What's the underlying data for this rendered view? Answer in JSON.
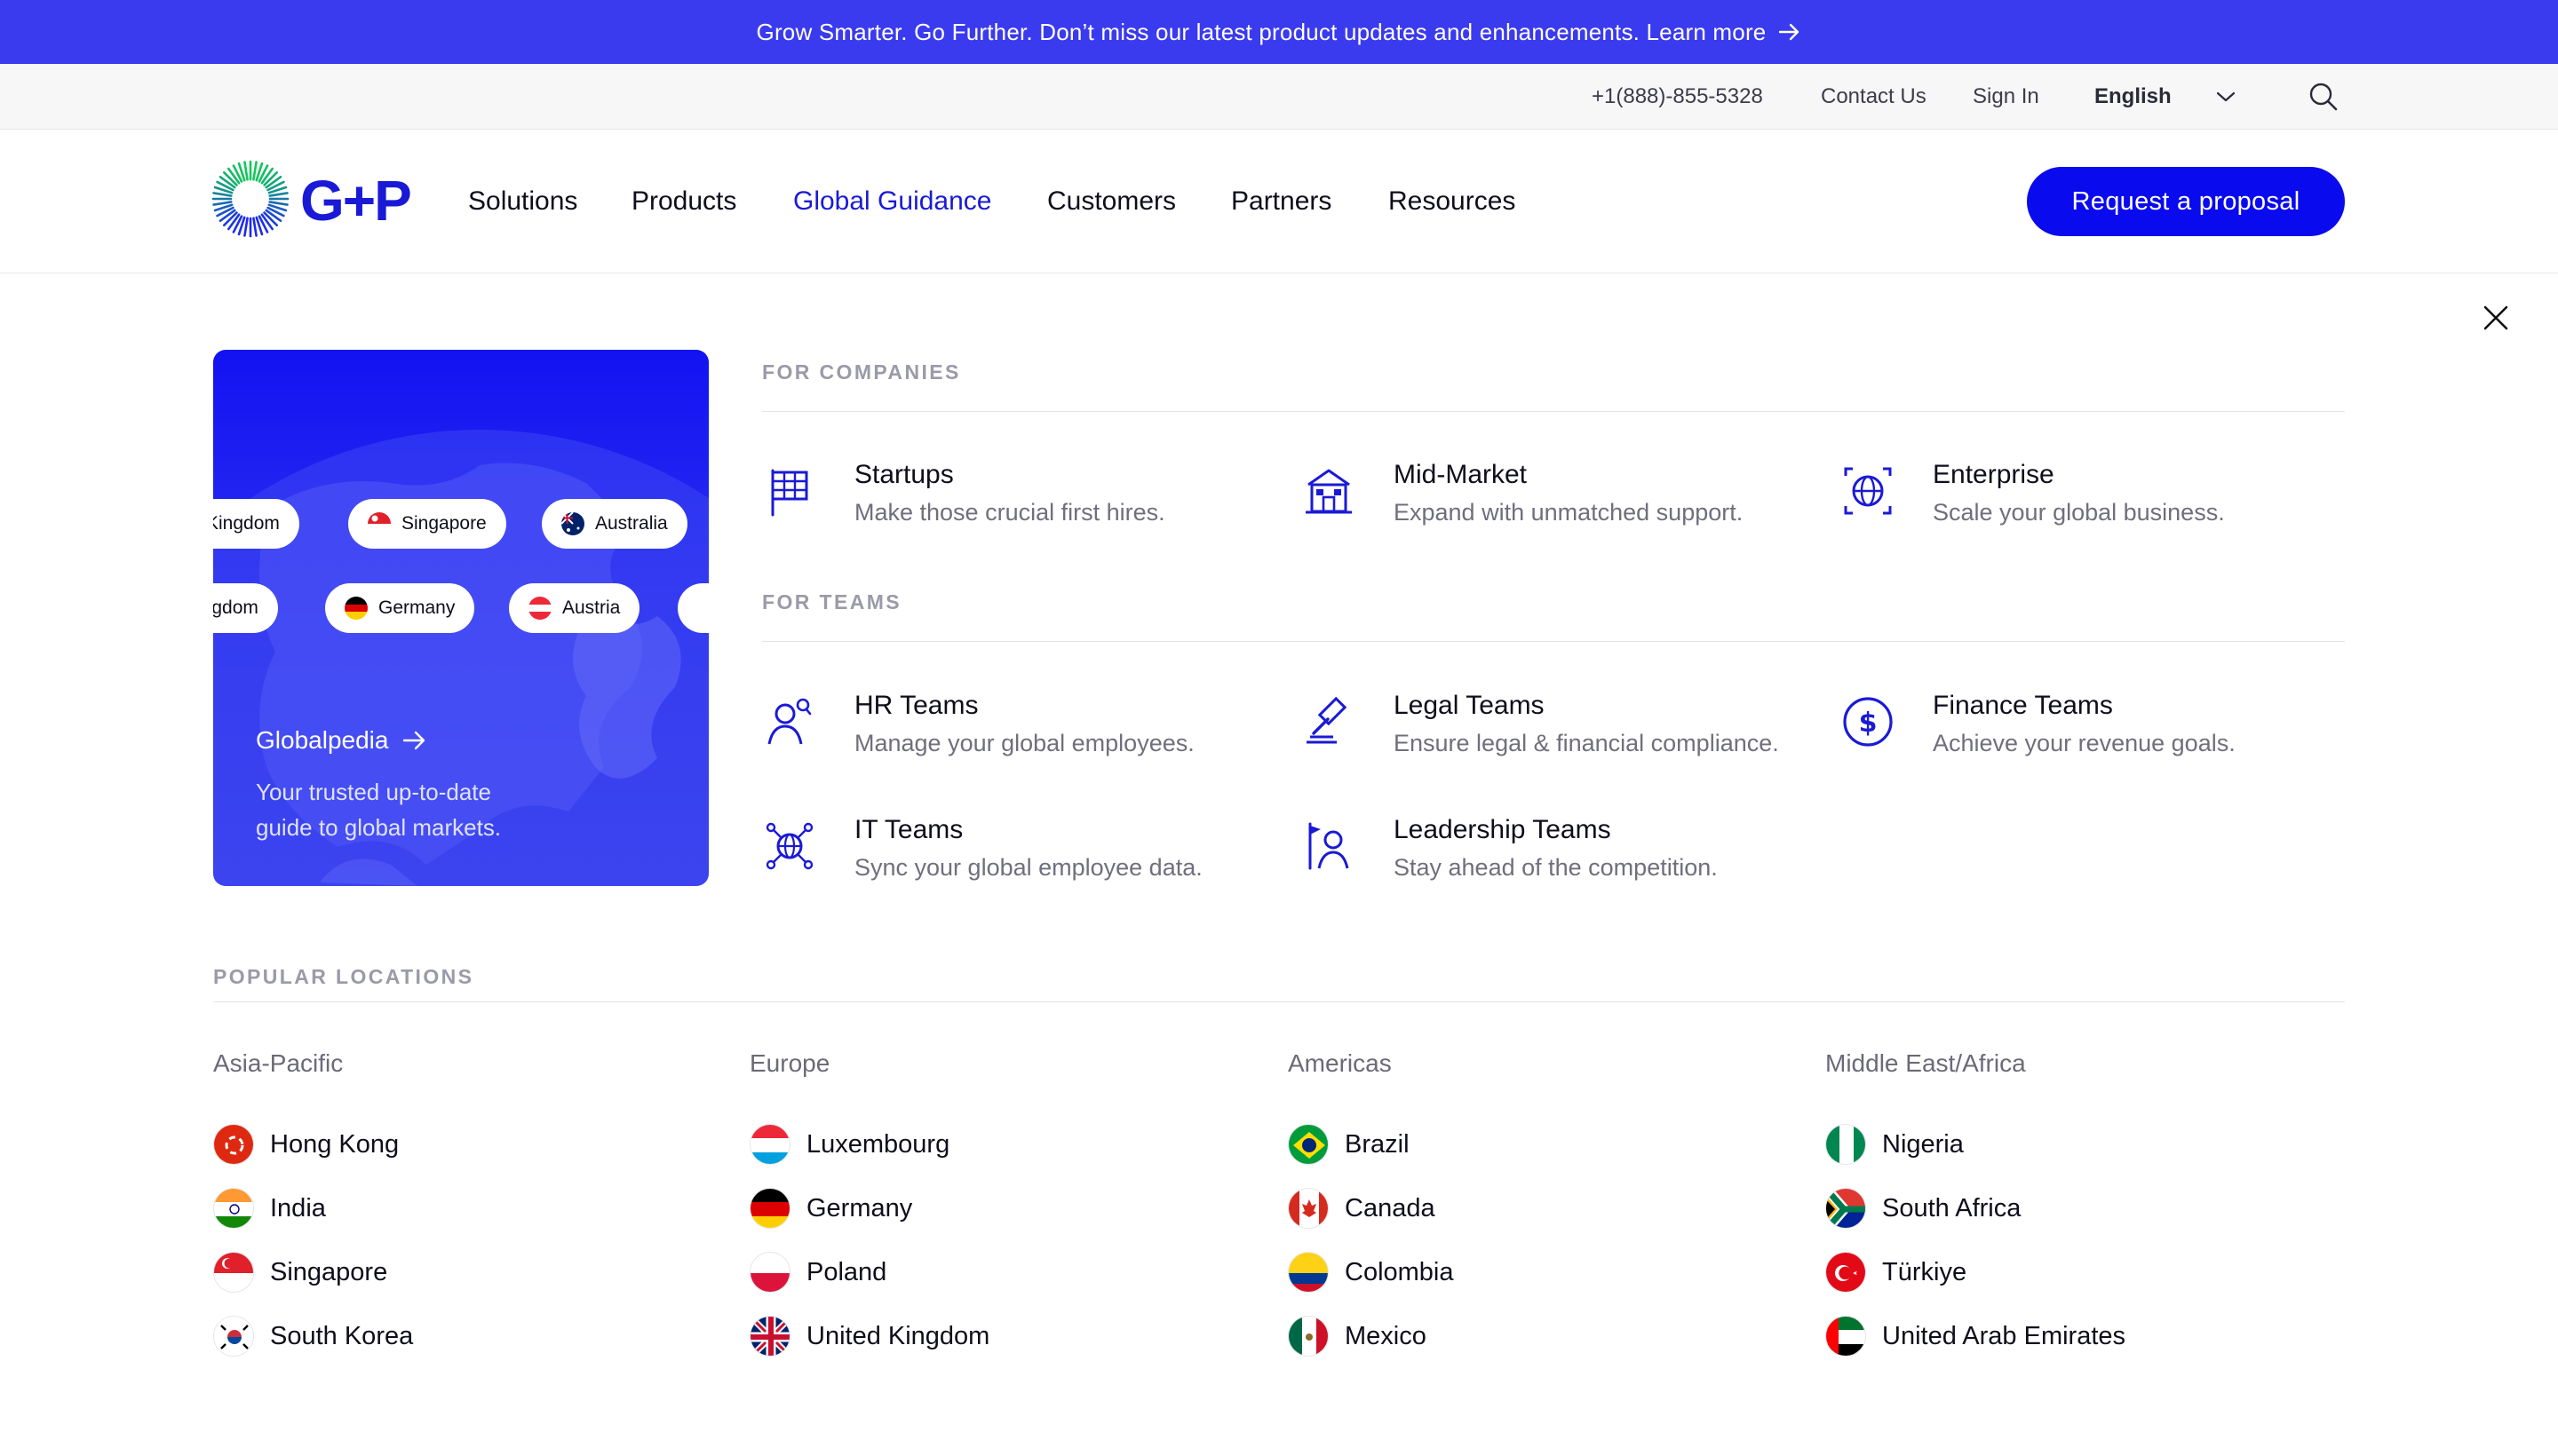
{
  "announcement": {
    "text": "Grow Smarter. Go Further. Don’t miss our latest product updates and enhancements. Learn more"
  },
  "utility": {
    "phone": "+1(888)-855-5328",
    "contact": "Contact Us",
    "sign_in": "Sign In",
    "language": "English"
  },
  "logo": {
    "text": "G+P"
  },
  "nav": {
    "items": [
      "Solutions",
      "Products",
      "Global Guidance",
      "Customers",
      "Partners",
      "Resources"
    ],
    "active": "Global Guidance",
    "cta": "Request a proposal"
  },
  "card": {
    "chips_row1": [
      "Kingdom",
      "Singapore",
      "Australia"
    ],
    "chips_row2": [
      "ingdom",
      "Germany",
      "Austria"
    ],
    "title": "Globalpedia",
    "description": "Your trusted up-to-date guide to global markets."
  },
  "for_companies": {
    "label": "FOR COMPANIES",
    "items": [
      {
        "title": "Startups",
        "desc": "Make those crucial first hires.",
        "icon": "flag-grid-icon"
      },
      {
        "title": "Mid-Market",
        "desc": "Expand with unmatched support.",
        "icon": "building-icon"
      },
      {
        "title": "Enterprise",
        "desc": "Scale your global business.",
        "icon": "globe-target-icon"
      }
    ]
  },
  "for_teams": {
    "label": "FOR TEAMS",
    "items": [
      {
        "title": "HR Teams",
        "desc": "Manage your global employees.",
        "icon": "person-search-icon"
      },
      {
        "title": "Legal Teams",
        "desc": "Ensure legal & financial compliance.",
        "icon": "gavel-icon"
      },
      {
        "title": "Finance Teams",
        "desc": "Achieve your revenue goals.",
        "icon": "dollar-circle-icon"
      },
      {
        "title": "IT Teams",
        "desc": "Sync your global employee data.",
        "icon": "network-globe-icon"
      },
      {
        "title": "Leadership Teams",
        "desc": "Stay ahead of the competition.",
        "icon": "leader-flag-icon"
      }
    ]
  },
  "popular": {
    "label": "POPULAR LOCATIONS",
    "regions": [
      {
        "name": "Asia-Pacific",
        "locations": [
          "Hong Kong",
          "India",
          "Singapore",
          "South Korea"
        ]
      },
      {
        "name": "Europe",
        "locations": [
          "Luxembourg",
          "Germany",
          "Poland",
          "United Kingdom"
        ]
      },
      {
        "name": "Americas",
        "locations": [
          "Brazil",
          "Canada",
          "Colombia",
          "Mexico"
        ]
      },
      {
        "name": "Middle East/Africa",
        "locations": [
          "Nigeria",
          "South Africa",
          "Türkiye",
          "United Arab Emirates"
        ]
      }
    ]
  },
  "colors": {
    "brand": "#0a0aee",
    "announce_bg": "#3a3aee",
    "active_nav": "#1a1ad6"
  }
}
